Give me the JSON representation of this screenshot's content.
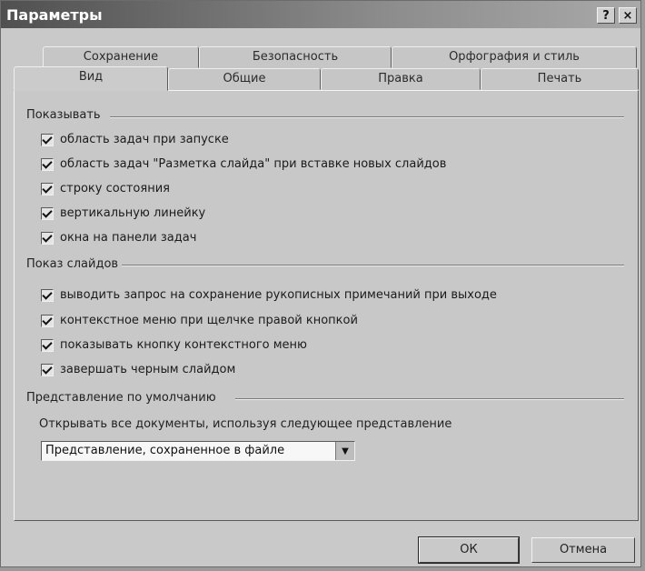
{
  "window": {
    "title": "Параметры",
    "help_label": "?",
    "close_label": "×"
  },
  "tabs": {
    "row_back": [
      "Сохранение",
      "Безопасность",
      "Орфография и стиль"
    ],
    "row_front": [
      "Вид",
      "Общие",
      "Правка",
      "Печать"
    ],
    "active": "Вид"
  },
  "groups": {
    "show": {
      "title": "Показывать",
      "items": [
        {
          "label": "область задач при запуске",
          "checked": true
        },
        {
          "label": "область задач \"Разметка слайда\" при вставке новых слайдов",
          "checked": true
        },
        {
          "label": "строку состояния",
          "checked": true
        },
        {
          "label": "вертикальную линейку",
          "checked": true
        },
        {
          "label": "окна на панели задач",
          "checked": true
        }
      ]
    },
    "slideshow": {
      "title": "Показ слайдов",
      "items": [
        {
          "label": "выводить запрос на сохранение рукописных примечаний при выходе",
          "checked": true
        },
        {
          "label": "контекстное меню при щелчке правой кнопкой",
          "checked": true
        },
        {
          "label": "показывать кнопку контекстного меню",
          "checked": true
        },
        {
          "label": "завершать черным слайдом",
          "checked": true
        }
      ]
    },
    "default_view": {
      "title": "Представление по умолчанию",
      "prompt": "Открывать все документы, используя следующее представление",
      "selected": "Представление, сохраненное в файле"
    }
  },
  "buttons": {
    "ok": "ОК",
    "cancel": "Отмена"
  },
  "icons": {
    "checkbox": "checkmark-icon",
    "dropdown": "chevron-down-icon"
  },
  "colors": {
    "dialog_bg": "#c9c9c9",
    "title_bar": "#505050"
  }
}
